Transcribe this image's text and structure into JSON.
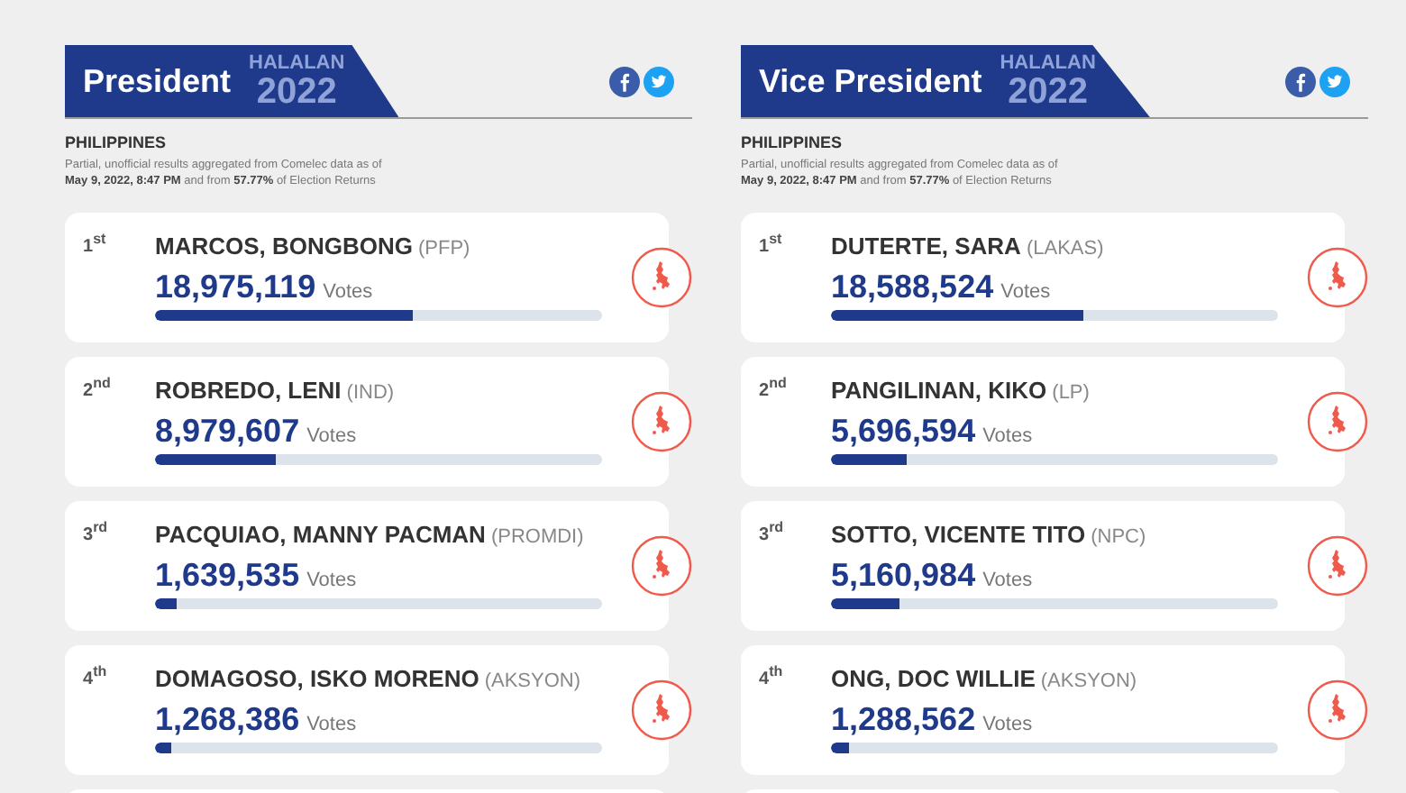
{
  "panels": [
    {
      "title": "President",
      "logo": {
        "line1": "HALALAN",
        "line2": "2022"
      },
      "region": "PHILIPPINES",
      "note": "Partial, unofficial results aggregated from Comelec data as of",
      "note2": "**May 9, 2022, 8:47 PM** and from **57.77%** of Election Returns",
      "candidates": [
        {
          "rank": "1$^{st}$",
          "name": "MARCOS, BONGBONG",
          "party": "(PFP)",
          "votes": "18,975,119",
          "votes_label": "Votes",
          "level": 0.577
        },
        {
          "rank": "2$^{nd}$",
          "name": "ROBREDO, LENI",
          "party": "(IND)",
          "votes": "8,979,607",
          "votes_label": "Votes",
          "level": 0.27
        },
        {
          "rank": "3$^{rd}$",
          "name": "PACQUIAO, MANNY PACMAN",
          "party": "(PROMDI)",
          "votes": "1,639,535",
          "votes_label": "Votes",
          "level": 0.05
        },
        {
          "rank": "4$^{th}$",
          "name": "DOMAGOSO, ISKO MORENO",
          "party": "(AKSYON)",
          "votes": "1,268,386",
          "votes_label": "Votes",
          "level": 0.035
        }
      ]
    },
    {
      "title": "Vice President",
      "logo": {
        "line1": "HALALAN",
        "line2": "2022"
      },
      "region": "PHILIPPINES",
      "note": "Partial, unofficial results aggregated from Comelec data as of",
      "note2": "**May 9, 2022, 8:47 PM** and from **57.77%** of Election Returns",
      "candidates": [
        {
          "rank": "1$^{st}$",
          "name": "DUTERTE, SARA",
          "party": "(LAKAS)",
          "votes": "18,588,524",
          "votes_label": "Votes",
          "level": 0.565
        },
        {
          "rank": "2$^{nd}$",
          "name": "PANGILINAN, KIKO",
          "party": "(LP)",
          "votes": "5,696,594",
          "votes_label": "Votes",
          "level": 0.17
        },
        {
          "rank": "3$^{rd}$",
          "name": "SOTTO, VICENTE TITO",
          "party": "(NPC)",
          "votes": "5,160,984",
          "votes_label": "Votes",
          "level": 0.155
        },
        {
          "rank": "4$^{th}$",
          "name": "ONG, DOC WILLIE",
          "party": "(AKSYON)",
          "votes": "1,288,562",
          "votes_label": "Votes",
          "level": 0.04
        }
      ]
    }
  ]
}
